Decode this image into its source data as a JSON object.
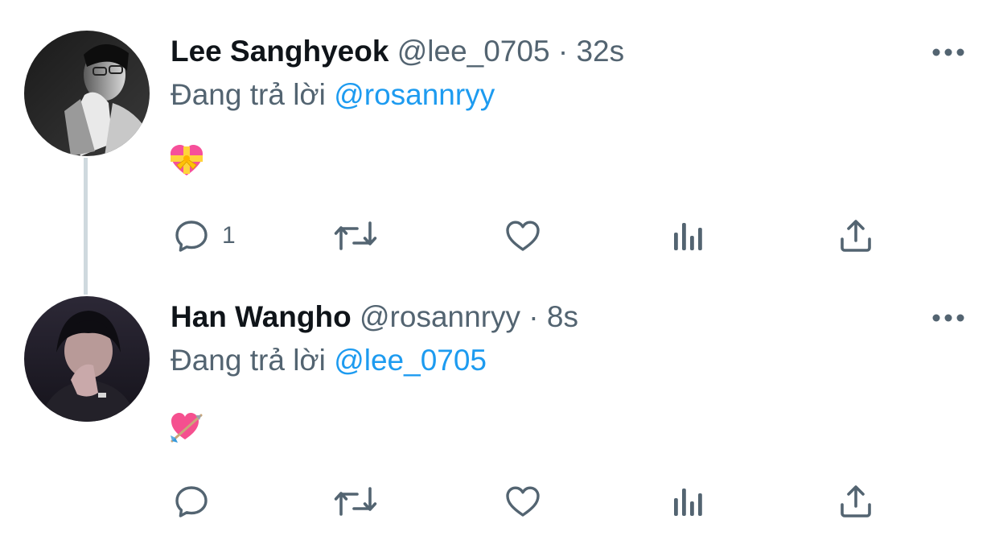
{
  "tweets": [
    {
      "display_name": "Lee Sanghyeok",
      "handle": "@lee_0705",
      "separator": "·",
      "time": "32s",
      "reply_prefix": "Đang trả lời",
      "reply_to": "@rosannryy",
      "emoji": "heart-with-ribbon-emoji",
      "reply_count": "1",
      "avatar": "avatar-grayscale-photo",
      "thread_line": true
    },
    {
      "display_name": "Han Wangho",
      "handle": "@rosannryy",
      "separator": "·",
      "time": "8s",
      "reply_prefix": "Đang trả lời",
      "reply_to": "@lee_0705",
      "emoji": "heart-with-arrow-emoji",
      "reply_count": "",
      "avatar": "avatar-dark-photo",
      "thread_line": false
    }
  ],
  "icons": {
    "more": "more-horizontal-icon",
    "reply": "reply-icon",
    "retweet": "retweet-icon",
    "like": "like-heart-icon",
    "views": "views-chart-icon",
    "share": "share-icon"
  },
  "colors": {
    "text_primary": "#0f1419",
    "text_secondary": "#536471",
    "mention": "#1d9bf0",
    "thread_line": "#cfd9de",
    "background": "#ffffff"
  }
}
